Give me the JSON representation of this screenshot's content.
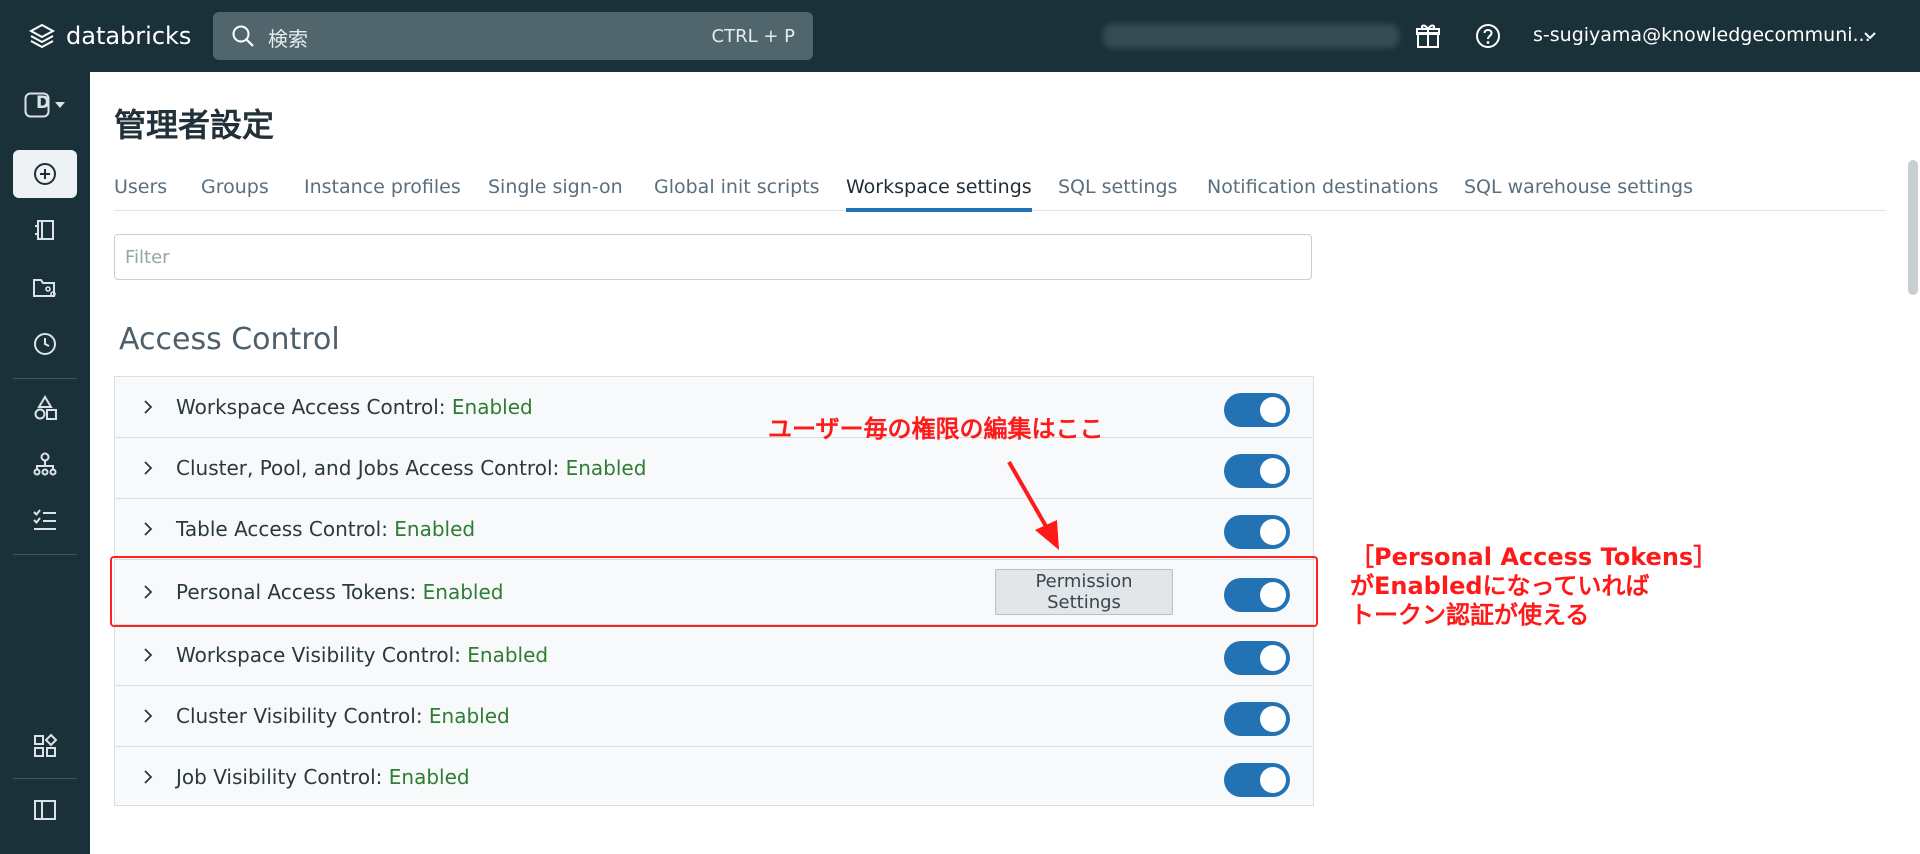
{
  "topbar": {
    "brand": "databricks",
    "search_placeholder": "検索",
    "search_shortcut": "CTRL + P",
    "user": "s-sugiyama@knowledgecommuni..."
  },
  "rail": {
    "workspace_badge": "D"
  },
  "page": {
    "title": "管理者設定",
    "tabs": [
      "Users",
      "Groups",
      "Instance profiles",
      "Single sign-on",
      "Global init scripts",
      "Workspace settings",
      "SQL settings",
      "Notification destinations",
      "SQL warehouse settings"
    ],
    "active_tab": "Workspace settings",
    "filter_placeholder": "Filter",
    "section_title": "Access Control"
  },
  "settings": [
    {
      "label": "Workspace Access Control: ",
      "value": "Enabled",
      "enabled": true
    },
    {
      "label": "Cluster, Pool, and Jobs Access Control: ",
      "value": "Enabled",
      "enabled": true
    },
    {
      "label": "Table Access Control: ",
      "value": "Enabled",
      "enabled": true
    },
    {
      "label": "Personal Access Tokens: ",
      "value": "Enabled",
      "enabled": true,
      "button": "Permission Settings"
    },
    {
      "label": "Workspace Visibility Control: ",
      "value": "Enabled",
      "enabled": true
    },
    {
      "label": "Cluster Visibility Control: ",
      "value": "Enabled",
      "enabled": true
    },
    {
      "label": "Job Visibility Control: ",
      "value": "Enabled",
      "enabled": true
    }
  ],
  "annotations": {
    "note_permission": "ユーザー毎の権限の編集はここ",
    "note_tokens_line1": "［Personal Access Tokens］",
    "note_tokens_line2": "がEnabledになっていれば",
    "note_tokens_line3": "トークン認証が使える"
  },
  "colors": {
    "topbar": "#1b3139",
    "accent": "#2272b4",
    "enabled_text": "#2e7d32",
    "annotation": "#ff1a1a"
  }
}
